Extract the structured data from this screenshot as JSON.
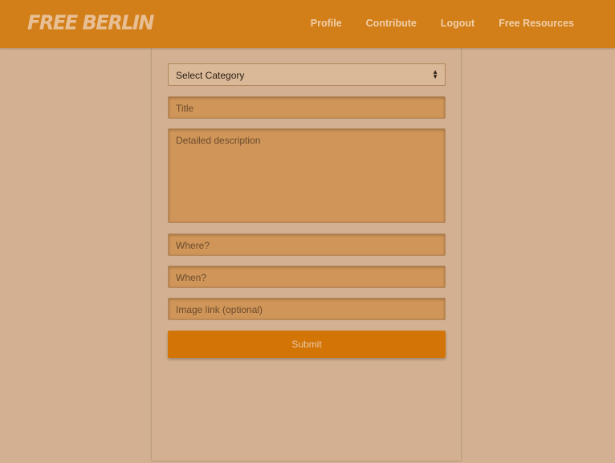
{
  "navbar": {
    "brand": "FREE BERLIN",
    "links": [
      "Profile",
      "Contribute",
      "Logout",
      "Free Resources"
    ]
  },
  "form": {
    "category_select": {
      "selected": "Select Category"
    },
    "title_placeholder": "Title",
    "description_placeholder": "Detailed description",
    "where_placeholder": "Where?",
    "when_placeholder": "When?",
    "image_placeholder": "Image link (optional)",
    "submit_label": "Submit"
  },
  "colors": {
    "navbar": "#d27f1a",
    "background": "#d2b091",
    "input": "#d09558",
    "button": "#d27406"
  }
}
